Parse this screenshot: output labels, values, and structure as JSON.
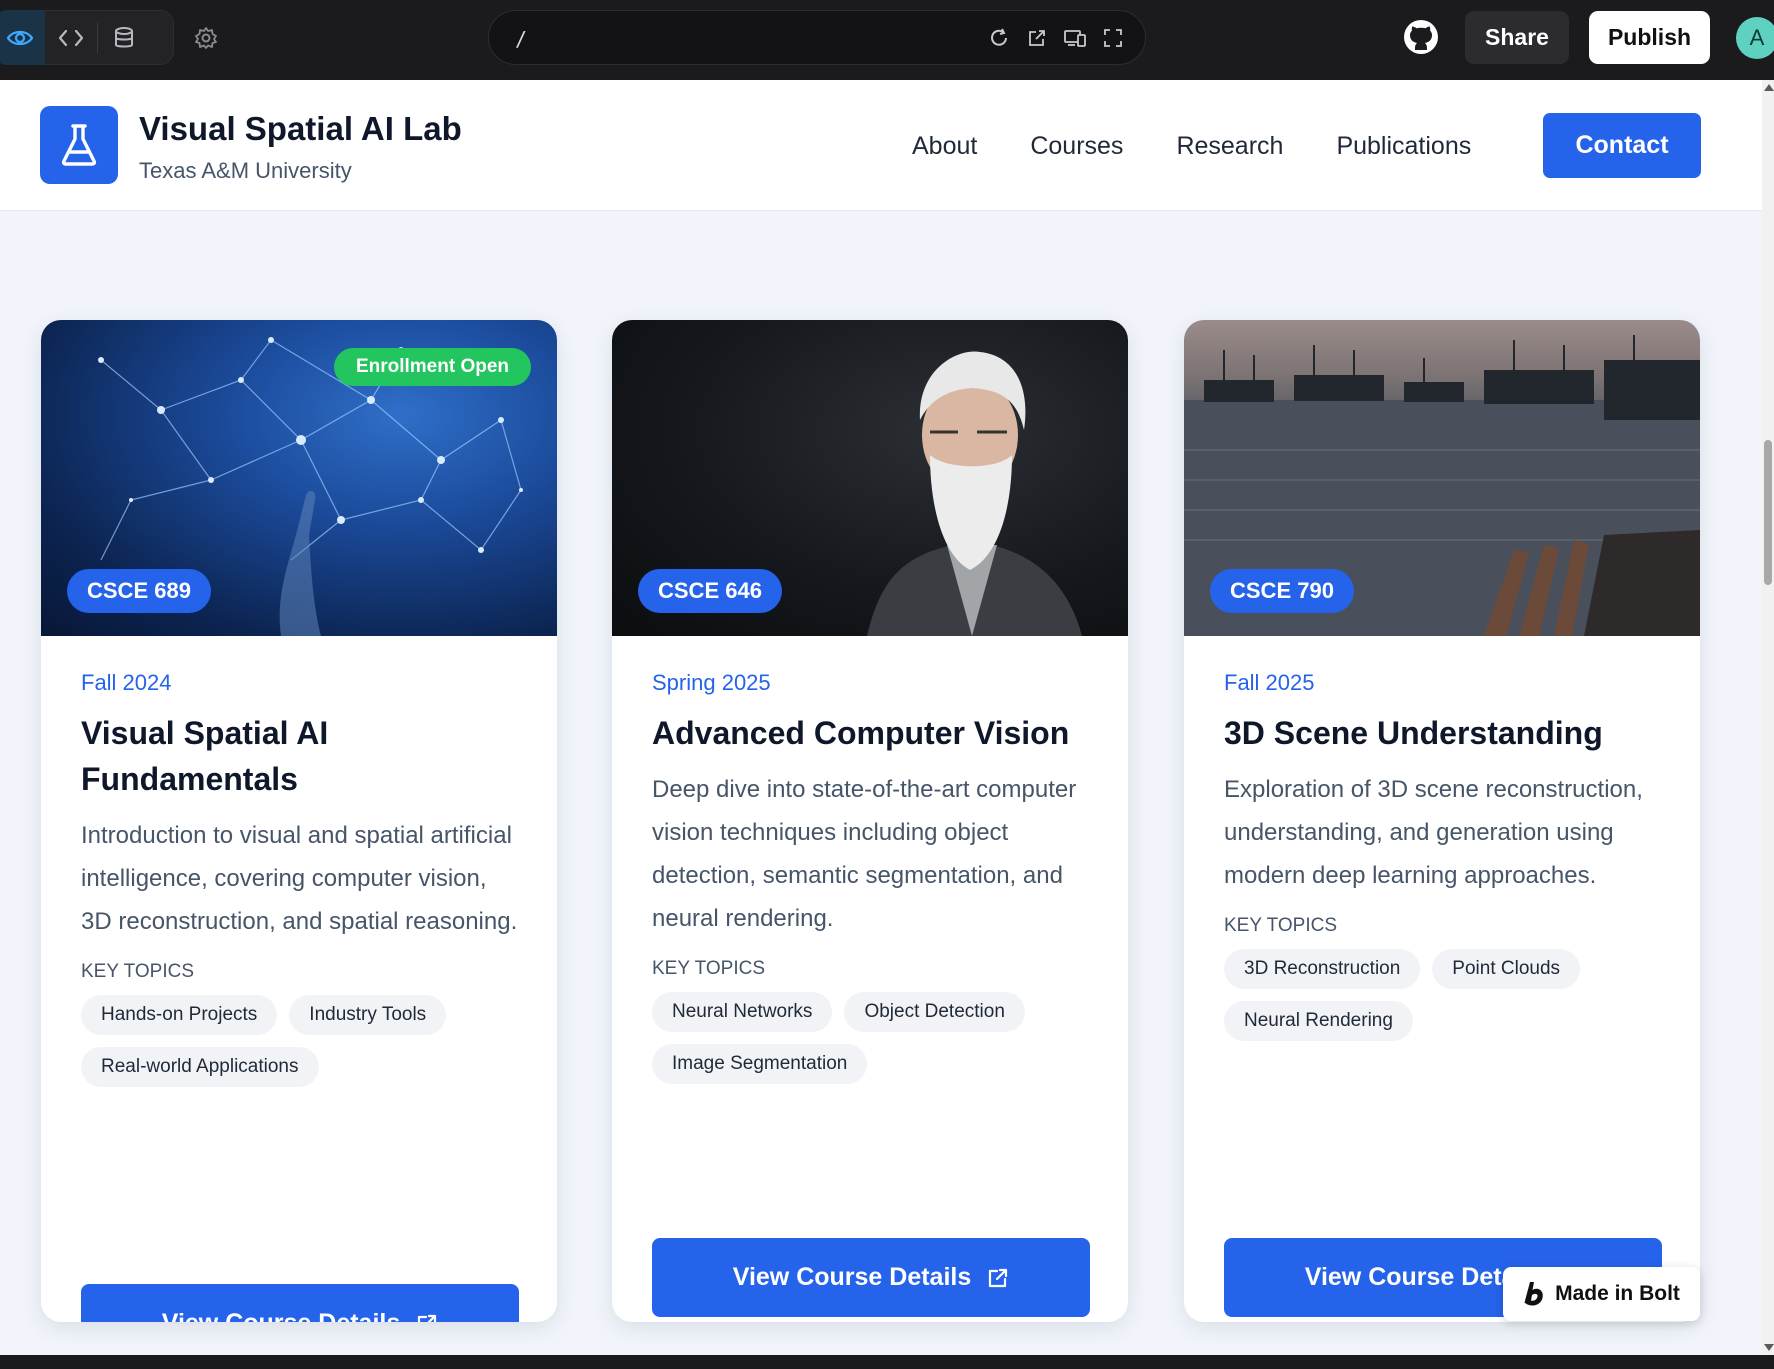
{
  "editor": {
    "url": "/",
    "share_label": "Share",
    "publish_label": "Publish",
    "avatar_initial": "A"
  },
  "site": {
    "name": "Visual Spatial AI Lab",
    "subtitle": "Texas A&M University",
    "nav": [
      "About",
      "Courses",
      "Research",
      "Publications"
    ],
    "contact_label": "Contact"
  },
  "courses": [
    {
      "code": "CSCE 689",
      "badge": "Enrollment Open",
      "term": "Fall 2024",
      "title": "Visual Spatial AI Fundamentals",
      "description": "Introduction to visual and spatial artificial intelligence, covering computer vision, 3D reconstruction, and spatial reasoning.",
      "topics_label": "KEY TOPICS",
      "topics": [
        "Hands-on Projects",
        "Industry Tools",
        "Real-world Applications"
      ],
      "button_label": "View Course Details"
    },
    {
      "code": "CSCE 646",
      "term": "Spring 2025",
      "title": "Advanced Computer Vision",
      "description": "Deep dive into state-of-the-art computer vision techniques including object detection, semantic segmentation, and neural rendering.",
      "topics_label": "KEY TOPICS",
      "topics": [
        "Neural Networks",
        "Object Detection",
        "Image Segmentation"
      ],
      "button_label": "View Course Details"
    },
    {
      "code": "CSCE 790",
      "term": "Fall 2025",
      "title": "3D Scene Understanding",
      "description": "Exploration of 3D scene reconstruction, understanding, and generation using modern deep learning approaches.",
      "topics_label": "KEY TOPICS",
      "topics": [
        "3D Reconstruction",
        "Point Clouds",
        "Neural Rendering"
      ],
      "button_label": "View Course Details"
    }
  ],
  "bolt_badge": "Made in Bolt",
  "colors": {
    "primary": "#2563eb",
    "success": "#22c55e",
    "heading": "#0f172a",
    "body_text": "#475569"
  }
}
